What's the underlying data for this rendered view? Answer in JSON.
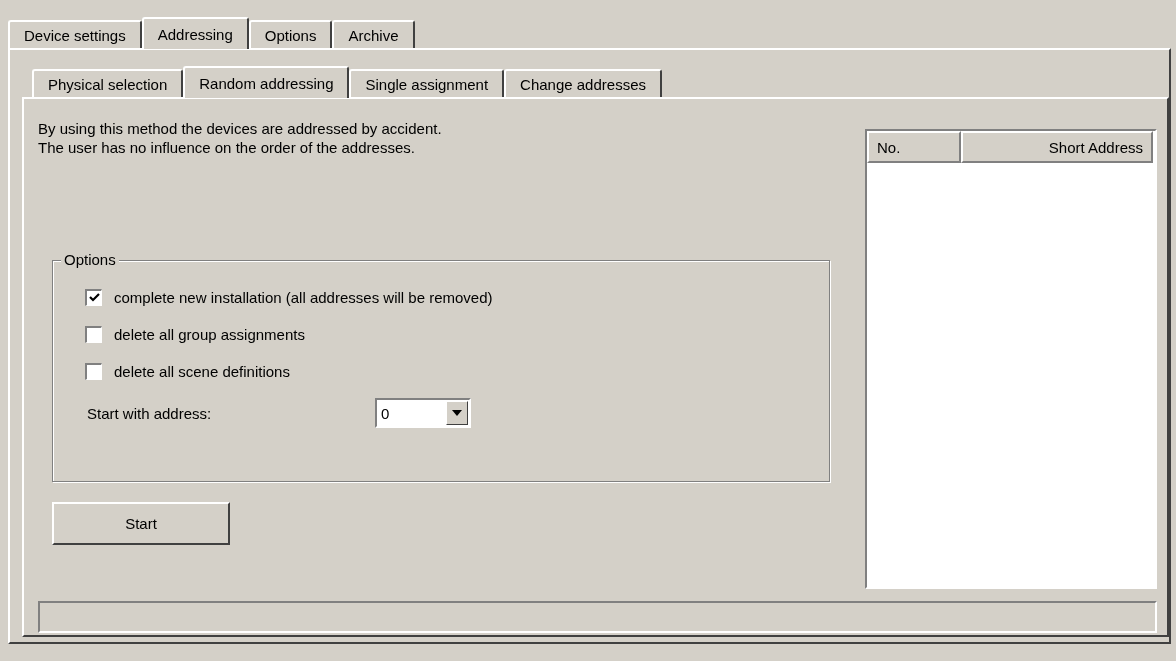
{
  "outer_tabs": [
    {
      "label": "Device settings",
      "selected": false
    },
    {
      "label": "Addressing",
      "selected": true
    },
    {
      "label": "Options",
      "selected": false
    },
    {
      "label": "Archive",
      "selected": false
    }
  ],
  "inner_tabs": [
    {
      "label": "Physical selection",
      "selected": false
    },
    {
      "label": "Random addressing",
      "selected": true
    },
    {
      "label": "Single assignment",
      "selected": false
    },
    {
      "label": "Change addresses",
      "selected": false
    }
  ],
  "description": [
    "By using this method the devices are addressed by accident.",
    "The user has no influence on the order of the addresses."
  ],
  "options": {
    "title": "Options",
    "checkboxes": [
      {
        "label": "complete new installation (all addresses will be removed)",
        "checked": true
      },
      {
        "label": "delete all group assignments",
        "checked": false
      },
      {
        "label": "delete all scene definitions",
        "checked": false
      }
    ],
    "start_address": {
      "label": "Start with address:",
      "value": "0"
    }
  },
  "start_button": "Start",
  "table": {
    "columns": [
      "No.",
      "Short Address"
    ]
  },
  "progress": {
    "level": 0
  }
}
